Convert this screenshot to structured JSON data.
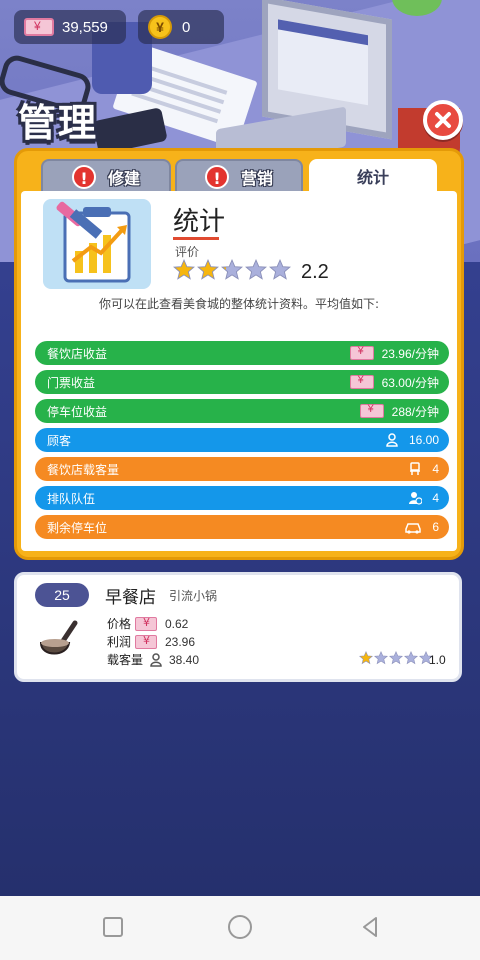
{
  "currency": {
    "money": "39,559",
    "coins": "0"
  },
  "title": "管理",
  "tabs": [
    {
      "label": "修建",
      "alert": "!"
    },
    {
      "label": "营销",
      "alert": "!"
    },
    {
      "label": "统计"
    }
  ],
  "stats": {
    "heading": "统计",
    "rating_label": "评价",
    "rating_value": "2.2",
    "rating_stars": 2.2,
    "rating_max": 5,
    "description": "你可以在此查看美食城的整体统计资料。平均值如下:",
    "rows": [
      {
        "label": "餐饮店收益",
        "value": "23.96/分钟",
        "icon": "cash-icon",
        "color": "#27b24a"
      },
      {
        "label": "门票收益",
        "value": "63.00/分钟",
        "icon": "cash-icon",
        "color": "#27b24a"
      },
      {
        "label": "停车位收益",
        "value": "288/分钟",
        "icon": "cash-icon",
        "color": "#27b24a"
      },
      {
        "label": "顾客",
        "value": "16.00",
        "icon": "person-icon",
        "color": "#1497ea"
      },
      {
        "label": "餐饮店载客量",
        "value": "4",
        "icon": "seat-icon",
        "color": "#f58a22"
      },
      {
        "label": "排队队伍",
        "value": "4",
        "icon": "queue-icon",
        "color": "#1497ea"
      },
      {
        "label": "剩余停车位",
        "value": "6",
        "icon": "car-icon",
        "color": "#f58a22"
      }
    ]
  },
  "shop": {
    "number": "25",
    "name": "早餐店",
    "subtitle": "引流小锅",
    "price_label": "价格",
    "price": "0.62",
    "profit_label": "利润",
    "profit": "23.96",
    "capacity_label": "载客量",
    "capacity": "38.40",
    "rating": "1.0",
    "rating_stars": 1
  },
  "colors": {
    "panel": "#f7b21a",
    "green": "#27b24a",
    "blue": "#1497ea",
    "orange": "#f58a22",
    "close": "#e84a40"
  }
}
